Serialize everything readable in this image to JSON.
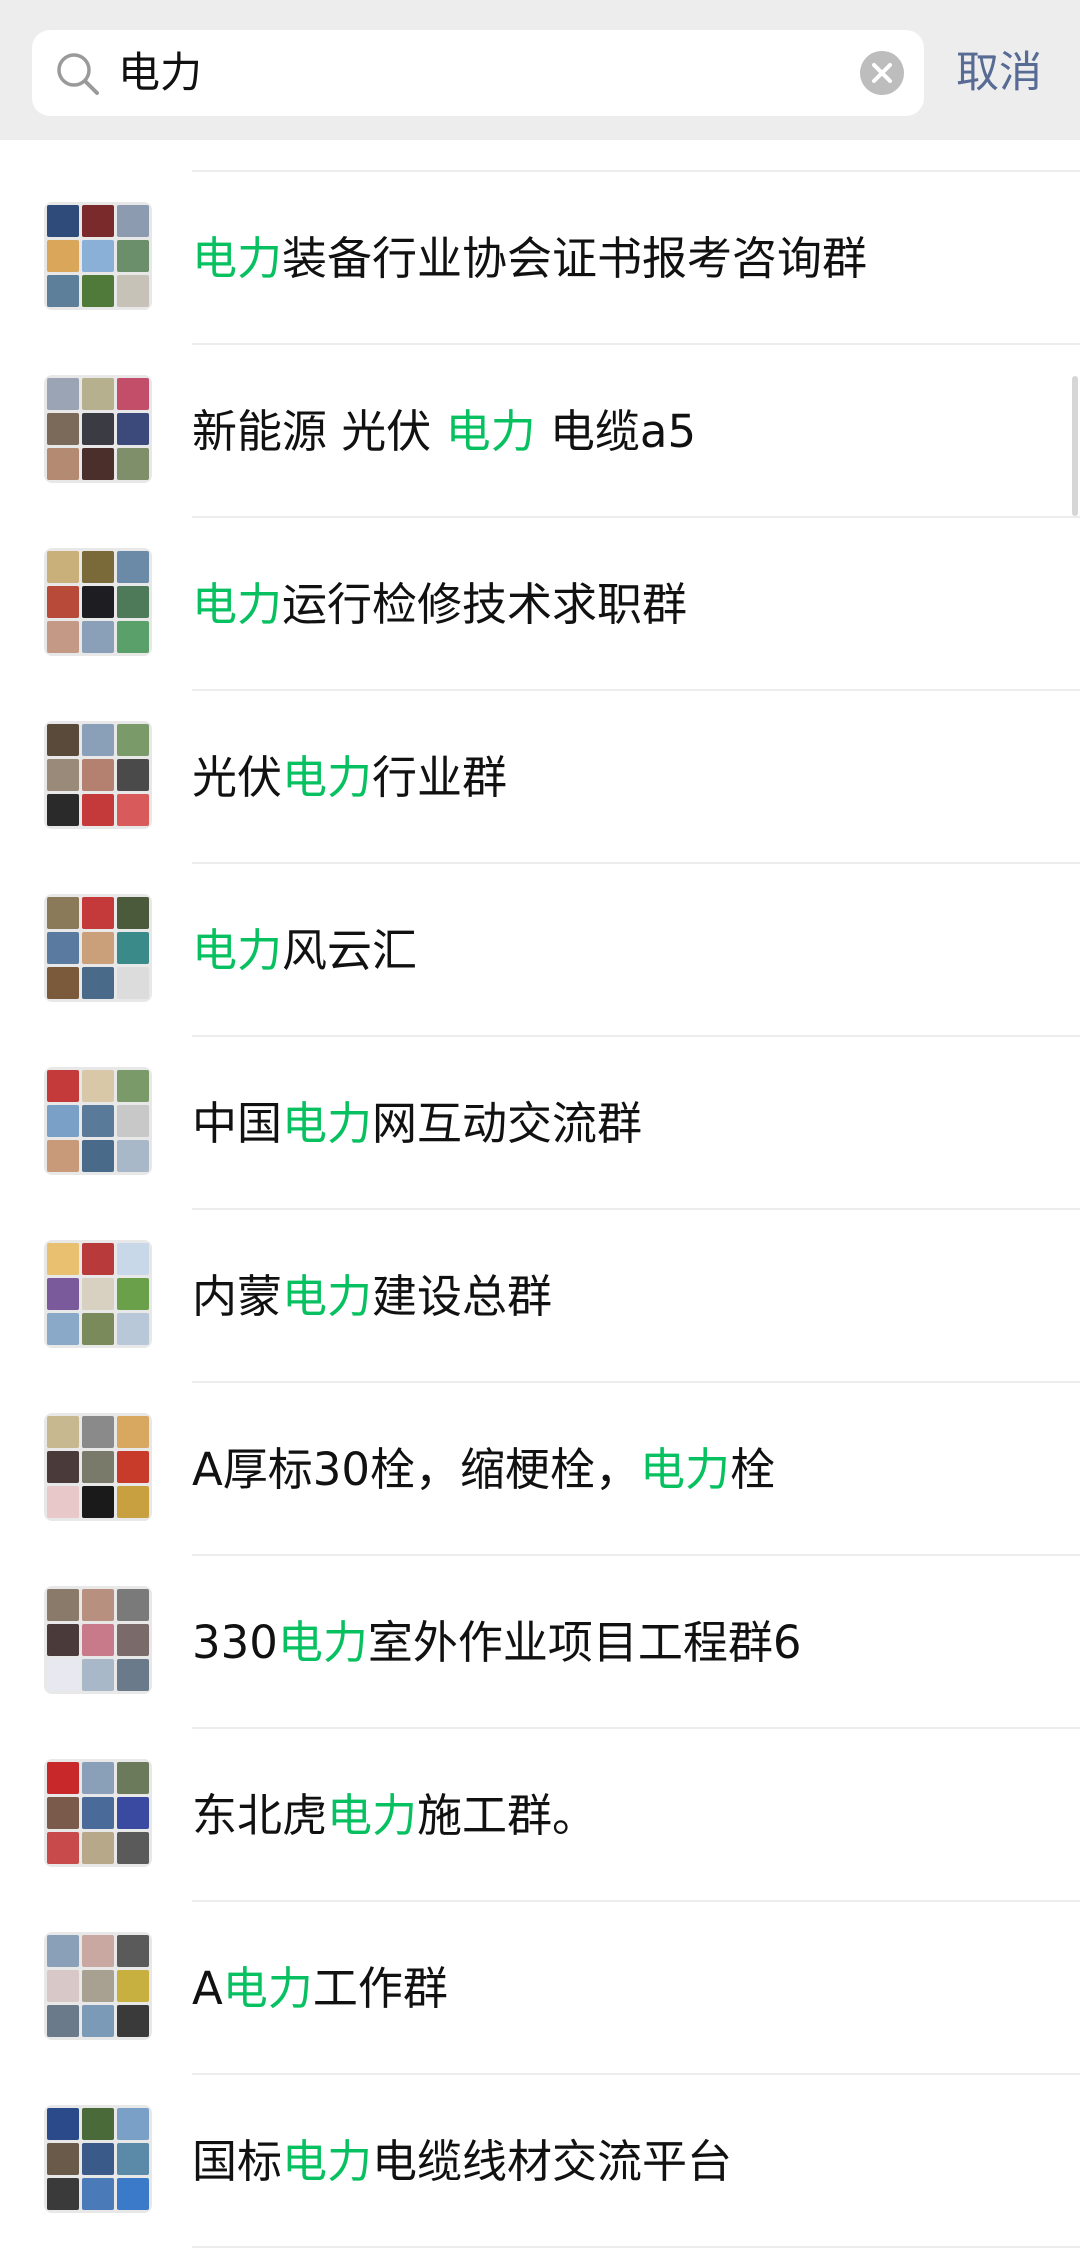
{
  "search": {
    "query": "电力",
    "cancel_label": "取消",
    "icon": "search-icon",
    "clear_icon": "clear-icon"
  },
  "results": [
    {
      "parts": [
        {
          "t": "电力",
          "hl": true
        },
        {
          "t": "装备行业协会证书报考咨询群",
          "hl": false
        }
      ],
      "colors": [
        "#2f4b7a",
        "#7a2a2a",
        "#8d9bb0",
        "#d9a65a",
        "#8ab0d8",
        "#6b8f6b",
        "#5d7f99",
        "#4f7a3a",
        "#c7c2b8"
      ]
    },
    {
      "parts": [
        {
          "t": "新能源 光伏 ",
          "hl": false
        },
        {
          "t": "电力",
          "hl": true
        },
        {
          "t": " 电缆a5",
          "hl": false
        }
      ],
      "colors": [
        "#9aa4b5",
        "#b7b08e",
        "#c24e6a",
        "#7b6a5a",
        "#3b3b44",
        "#3b4a7a",
        "#b48a72",
        "#4a2f2a",
        "#7e8f6a"
      ]
    },
    {
      "parts": [
        {
          "t": "电力",
          "hl": true
        },
        {
          "t": "运行检修技术求职群",
          "hl": false
        }
      ],
      "colors": [
        "#c9b07a",
        "#7a6a3a",
        "#6a8aa8",
        "#b84a3a",
        "#1e1e22",
        "#4f7a5a",
        "#c49a86",
        "#8aa0b8",
        "#5aa06a"
      ]
    },
    {
      "parts": [
        {
          "t": "光伏",
          "hl": false
        },
        {
          "t": "电力",
          "hl": true
        },
        {
          "t": "行业群",
          "hl": false
        }
      ],
      "colors": [
        "#5a4a3a",
        "#8aa0b8",
        "#7a9a6a",
        "#9a8a7a",
        "#b48070",
        "#4a4a4a",
        "#2a2a2a",
        "#c43a3a",
        "#d85a5a"
      ]
    },
    {
      "parts": [
        {
          "t": "电力",
          "hl": true
        },
        {
          "t": "风云汇",
          "hl": false
        }
      ],
      "colors": [
        "#8a7a5a",
        "#c43a3a",
        "#4a5a3a",
        "#5a7aa0",
        "#c9a07a",
        "#3a8a8a",
        "#7a5a3a",
        "#4a6a8a",
        "#dcdcdc"
      ]
    },
    {
      "parts": [
        {
          "t": "中国",
          "hl": false
        },
        {
          "t": "电力",
          "hl": true
        },
        {
          "t": "网互动交流群",
          "hl": false
        }
      ],
      "colors": [
        "#c43a3a",
        "#d8c8a8",
        "#7a9a6a",
        "#7aa0c8",
        "#5a7a9a",
        "#c8c8c8",
        "#c89a7a",
        "#4a6a8a",
        "#a8b8c8"
      ]
    },
    {
      "parts": [
        {
          "t": "内蒙",
          "hl": false
        },
        {
          "t": "电力",
          "hl": true
        },
        {
          "t": "建设总群",
          "hl": false
        }
      ],
      "colors": [
        "#e8c070",
        "#b83a3a",
        "#c8d8e8",
        "#7a5a9a",
        "#d8d0c0",
        "#6aa04a",
        "#8aa8c8",
        "#7a8a5a",
        "#b8c8d8"
      ]
    },
    {
      "parts": [
        {
          "t": "A厚标30栓，缩梗栓，",
          "hl": false
        },
        {
          "t": "电力",
          "hl": true
        },
        {
          "t": "栓",
          "hl": false
        }
      ],
      "colors": [
        "#c8b890",
        "#8a8a8a",
        "#d8a860",
        "#4a3a3a",
        "#7a7a6a",
        "#c83a2a",
        "#e8c8c8",
        "#1a1a1a",
        "#c8a040"
      ]
    },
    {
      "parts": [
        {
          "t": "330",
          "hl": false
        },
        {
          "t": "电力",
          "hl": true
        },
        {
          "t": "室外作业项目工程群6",
          "hl": false
        }
      ],
      "colors": [
        "#8a7a6a",
        "#b89080",
        "#7a7a7a",
        "#4a3a3a",
        "#c87a8a",
        "#7a6a6a",
        "#e8e8f0",
        "#a8b8c8",
        "#6a7a8a"
      ]
    },
    {
      "parts": [
        {
          "t": "东北虎",
          "hl": false
        },
        {
          "t": "电力",
          "hl": true
        },
        {
          "t": "施工群。",
          "hl": false
        }
      ],
      "colors": [
        "#c8282a",
        "#8aa0b8",
        "#6a7a5a",
        "#7a5a4a",
        "#4a6a9a",
        "#3a4aa0",
        "#c84a4a",
        "#b8a88a",
        "#5a5a5a"
      ]
    },
    {
      "parts": [
        {
          "t": "A",
          "hl": false
        },
        {
          "t": "电力",
          "hl": true
        },
        {
          "t": "工作群",
          "hl": false
        }
      ],
      "colors": [
        "#8aa0b8",
        "#c8a8a0",
        "#5a5a5a",
        "#d8c8c8",
        "#a8a090",
        "#c8b040",
        "#6a7a8a",
        "#7a9ab8",
        "#3a3a3a"
      ]
    },
    {
      "parts": [
        {
          "t": "国标",
          "hl": false
        },
        {
          "t": "电力",
          "hl": true
        },
        {
          "t": "电缆线材交流平台",
          "hl": false
        }
      ],
      "colors": [
        "#2a4a8a",
        "#4a6a3a",
        "#7aa0c8",
        "#6a5a4a",
        "#3a5a8a",
        "#5a8aa8",
        "#3a3a3a",
        "#4a7ab8",
        "#3a7ac8"
      ]
    }
  ]
}
